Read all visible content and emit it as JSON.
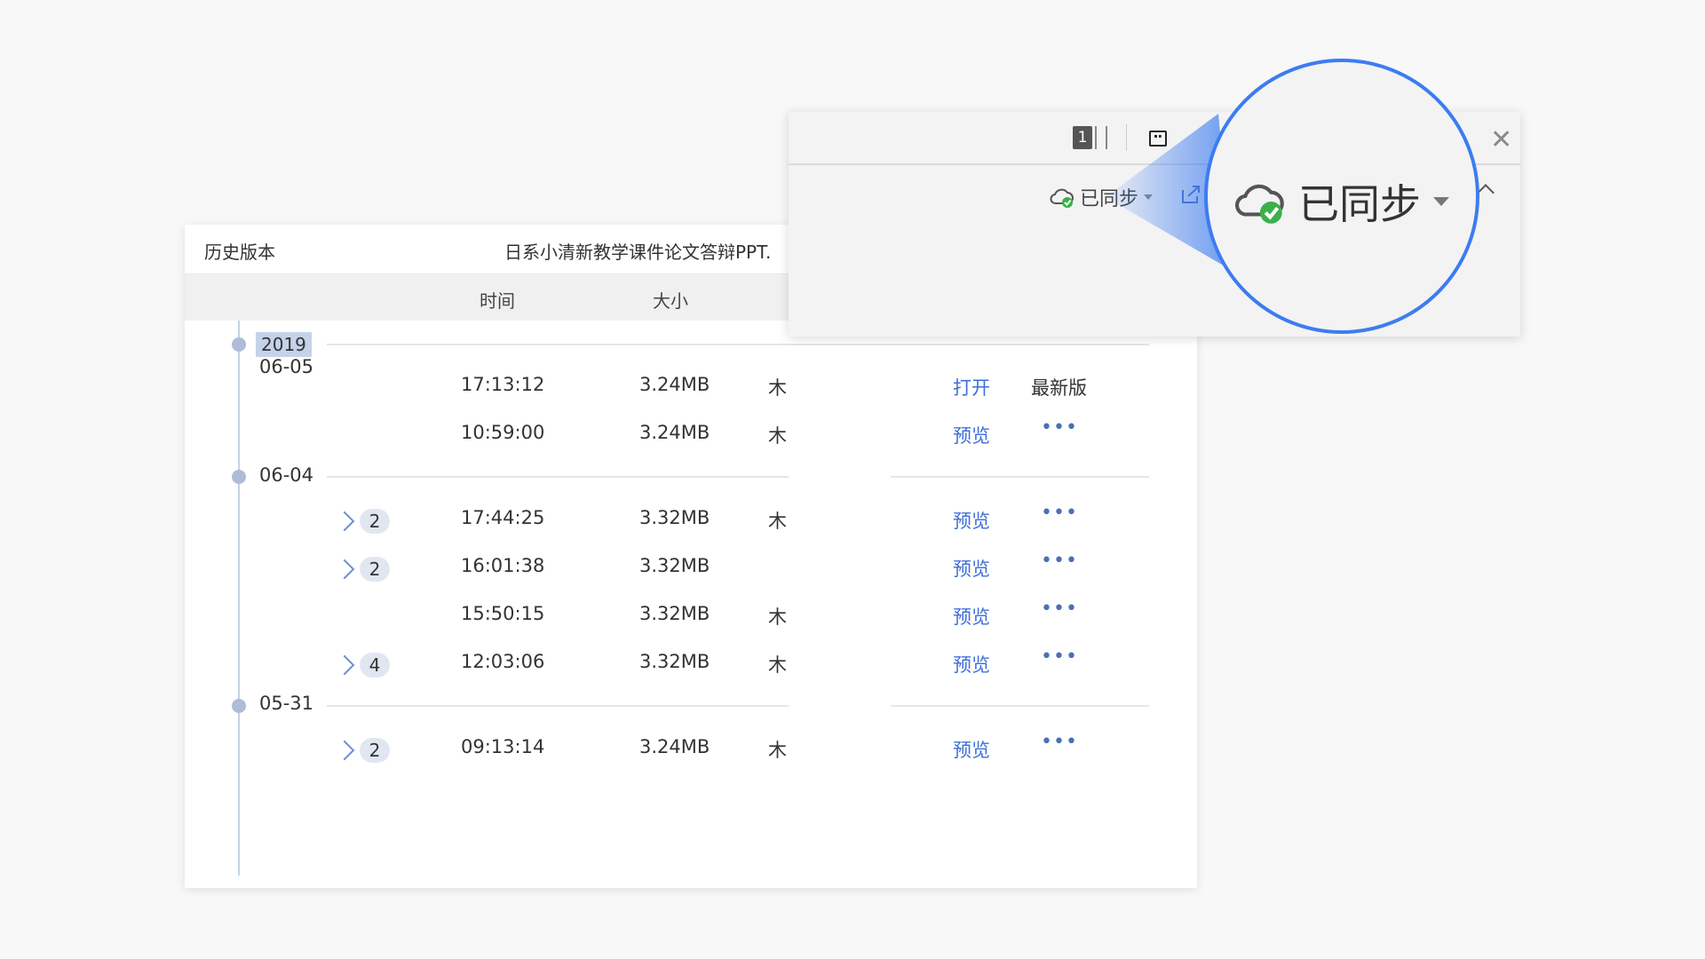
{
  "history": {
    "title": "历史版本",
    "filename": "日系小清新教学课件论文答辩PPT.",
    "columns": {
      "time": "时间",
      "size": "大小"
    },
    "groups": [
      {
        "year": "2019",
        "date": "06-05",
        "rows": [
          {
            "time": "17:13:12",
            "size": "3.24MB",
            "author": "木",
            "action": "打开",
            "status": "最新版"
          },
          {
            "time": "10:59:00",
            "size": "3.24MB",
            "author": "木",
            "action": "预览",
            "more": "•••"
          }
        ]
      },
      {
        "date": "06-04",
        "rows": [
          {
            "count": "2",
            "time": "17:44:25",
            "size": "3.32MB",
            "author": "木",
            "action": "预览",
            "more": "•••"
          },
          {
            "count": "2",
            "time": "16:01:38",
            "size": "3.32MB",
            "author": "",
            "action": "预览",
            "more": "•••"
          },
          {
            "time": "15:50:15",
            "size": "3.32MB",
            "author": "木",
            "action": "预览",
            "more": "•••"
          },
          {
            "count": "4",
            "time": "12:03:06",
            "size": "3.32MB",
            "author": "木",
            "action": "预览",
            "more": "•••"
          }
        ]
      },
      {
        "date": "05-31",
        "rows": [
          {
            "count": "2",
            "time": "09:13:14",
            "size": "3.24MB",
            "author": "木",
            "action": "预览",
            "more": "•••"
          }
        ]
      }
    ]
  },
  "toolbar": {
    "page_count": "1",
    "sync_label": "已同步",
    "close_icon": "close-icon",
    "window_icon": "window-icon",
    "share_icon": "share-icon"
  },
  "magnifier": {
    "sync_label": "已同步"
  },
  "colors": {
    "accent": "#3d7cf0",
    "link": "#3d6fd9",
    "success": "#3cb04a"
  }
}
